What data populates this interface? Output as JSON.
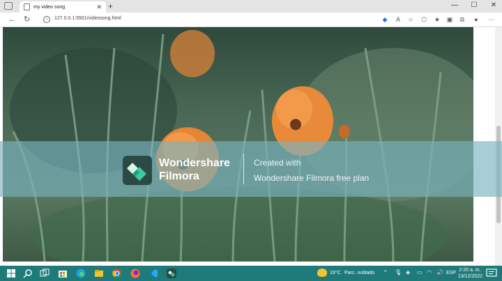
{
  "browser": {
    "tab_title": "my video song",
    "new_tab_label": "+",
    "url": "127.0.0.1:5501/videosong.html",
    "nav": {
      "back": "←",
      "refresh": "↻"
    },
    "window": {
      "minimize": "—",
      "maximize": "☐",
      "close": "✕"
    },
    "info_glyph": "i",
    "tab_close": "✕"
  },
  "toolbar_icons": [
    "tag-icon",
    "read-aloud-icon",
    "favorite-add-icon",
    "extensions-icon",
    "favorites-icon",
    "collections-icon",
    "profile-icon",
    "menu-icon"
  ],
  "video": {
    "brand_line1": "Wondershare",
    "brand_line2": "Filmora",
    "watermark_line1": "Created with",
    "watermark_line2": "Wondershare Filmora free plan"
  },
  "taskbar": {
    "weather_temp": "19°C",
    "weather_desc": "Parc. nublado",
    "language": "ESP",
    "time": "2:20 a. m.",
    "date": "13/12/2022",
    "tray": {
      "chevron": "^"
    }
  },
  "colors": {
    "taskbar": "#1f7a7a",
    "banner": "#7ab2be",
    "flower": "#e98a3a",
    "stem": "#5f8b6a"
  }
}
